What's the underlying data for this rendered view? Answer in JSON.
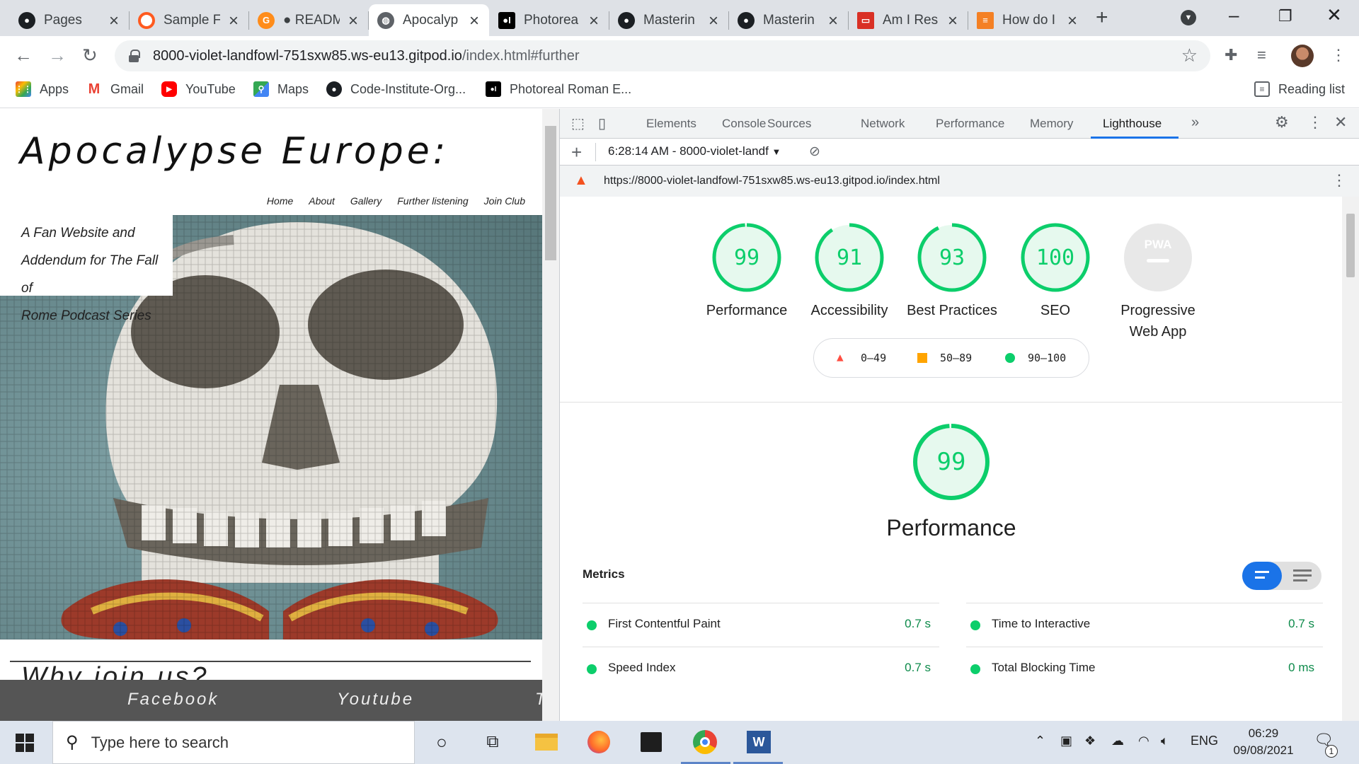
{
  "browser": {
    "tabs": [
      {
        "title": "Pages"
      },
      {
        "title": "Sample F"
      },
      {
        "title": "● READM"
      },
      {
        "title": "Apocalyp"
      },
      {
        "title": "Photorea"
      },
      {
        "title": "Masterin"
      },
      {
        "title": "Masterin"
      },
      {
        "title": "Am I Res"
      },
      {
        "title": "How do I"
      }
    ],
    "url_host": "8000-violet-landfowl-751sxw85.ws-eu13.gitpod.io",
    "url_path": "/index.html#further",
    "bookmarks": [
      {
        "label": "Apps"
      },
      {
        "label": "Gmail"
      },
      {
        "label": "YouTube"
      },
      {
        "label": "Maps"
      },
      {
        "label": "Code-Institute-Org..."
      },
      {
        "label": "Photoreal Roman E..."
      }
    ],
    "reading_list": "Reading list"
  },
  "site": {
    "title": "Apocalypse Europe:",
    "nav": [
      "Home",
      "About",
      "Gallery",
      "Further listening",
      "Join Club"
    ],
    "tagline": [
      "A Fan Website and",
      "Addendum for The Fall of",
      "Rome Podcast Series"
    ],
    "why_heading": "Why join us?",
    "footer": [
      "Facebook",
      "Youtube",
      "T"
    ]
  },
  "devtools": {
    "tabs": [
      "Elements",
      "Console",
      "Sources",
      "Network",
      "Performance",
      "Memory",
      "Lighthouse"
    ],
    "more": "»",
    "report_select": "6:28:14 AM - 8000-violet-landf",
    "report_url": "https://8000-violet-landfowl-751sxw85.ws-eu13.gitpod.io/index.html",
    "gauges": [
      {
        "score": "99",
        "label": "Performance",
        "fraction": 0.99
      },
      {
        "score": "91",
        "label": "Accessibility",
        "fraction": 0.91
      },
      {
        "score": "93",
        "label": "Best Practices",
        "fraction": 0.93
      },
      {
        "score": "100",
        "label": "SEO",
        "fraction": 1.0
      }
    ],
    "pwa": {
      "badge": "PWA",
      "label": "Progressive Web App"
    },
    "legend": [
      "0–49",
      "50–89",
      "90–100"
    ],
    "perf_score": "99",
    "perf_title": "Performance",
    "metrics_title": "Metrics",
    "metrics": [
      {
        "label": "First Contentful Paint",
        "value": "0.7 s"
      },
      {
        "label": "Time to Interactive",
        "value": "0.7 s"
      },
      {
        "label": "Speed Index",
        "value": "0.7 s"
      },
      {
        "label": "Total Blocking Time",
        "value": "0 ms"
      }
    ],
    "colors": {
      "pass": "#0cce6b",
      "average": "#ffa400",
      "fail": "#ff4e42",
      "accent": "#1a73e8"
    }
  },
  "taskbar": {
    "search_placeholder": "Type here to search",
    "language": "ENG",
    "time": "06:29",
    "date": "09/08/2021",
    "notifications": "1"
  }
}
